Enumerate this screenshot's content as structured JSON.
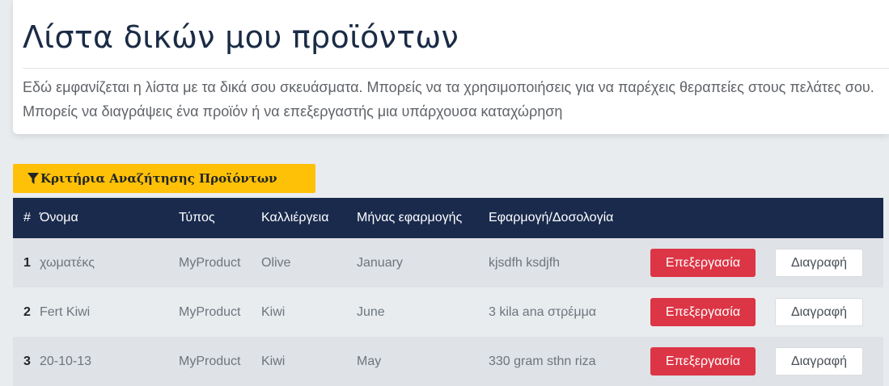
{
  "header": {
    "top_link": "",
    "title": "Λίστα δικών μου προϊόντων",
    "description": "Εδώ εμφανίζεται η λίστα με τα δικά σου σκευάσματα. Μπορείς να τα χρησιμοποιήσεις για να παρέχεις θεραπείες στους πελάτες σου. Μπορείς να διαγράψεις ένα προϊόν ή να επεξεργαστής μια υπάρχουσα καταχώρηση"
  },
  "filter": {
    "label": "Κριτήρια Αναζήτησης Προϊόντων",
    "icon": "filter-icon"
  },
  "table": {
    "headers": [
      "#",
      "Όνομα",
      "Τύπος",
      "Καλλιέργεια",
      "Μήνας εφαρμογής",
      "Εφαρμογή/Δοσολογία"
    ],
    "rows": [
      {
        "num": "1",
        "name": "χωματέκς",
        "type": "MyProduct",
        "crop": "Olive",
        "month": "January",
        "dosage": "kjsdfh ksdjfh",
        "edit": "Επεξεργασία",
        "delete": "Διαγραφή"
      },
      {
        "num": "2",
        "name": "Fert Kiwi",
        "type": "MyProduct",
        "crop": "Kiwi",
        "month": "June",
        "dosage": "3 kila ana στρέμμα",
        "edit": "Επεξεργασία",
        "delete": "Διαγραφή"
      },
      {
        "num": "3",
        "name": "20-10-13",
        "type": "MyProduct",
        "crop": "Kiwi",
        "month": "May",
        "dosage": "330 gram sthn riza",
        "edit": "Επεξεργασία",
        "delete": "Διαγραφή"
      }
    ]
  },
  "colors": {
    "header_bg": "#192a4d",
    "filter_button": "#ffc107",
    "edit_button": "#dc3545",
    "page_bg": "#e9ecef"
  }
}
